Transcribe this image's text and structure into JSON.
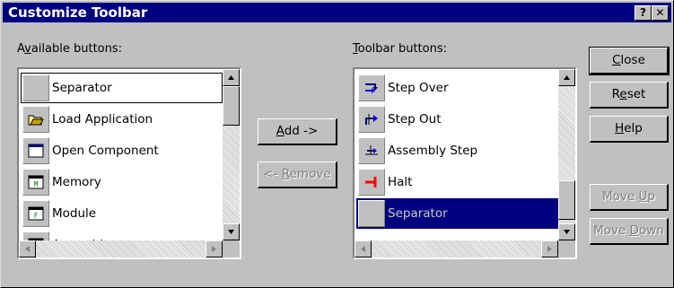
{
  "window": {
    "title": "Customize Toolbar",
    "help_glyph": "?",
    "close_glyph": "✕"
  },
  "available": {
    "label_pre": "A",
    "label_mn": "v",
    "label_post": "ailable buttons:",
    "items": [
      {
        "label": "Separator",
        "icon": "blank-icon"
      },
      {
        "label": "Load Application",
        "icon": "folder-open-icon"
      },
      {
        "label": "Open Component",
        "icon": "window-icon"
      },
      {
        "label": "Memory",
        "icon": "memory-icon",
        "glyph": "M"
      },
      {
        "label": "Module",
        "icon": "module-icon",
        "glyph": "F"
      },
      {
        "label": "Assembly",
        "icon": "assembly-icon",
        "glyph": "A"
      }
    ]
  },
  "toolbar": {
    "label_mn": "T",
    "label_post": "oolbar buttons:",
    "items": [
      {
        "label": "Step Over",
        "icon": "step-over-icon"
      },
      {
        "label": "Step Out",
        "icon": "step-out-icon"
      },
      {
        "label": "Assembly Step",
        "icon": "assembly-step-icon"
      },
      {
        "label": "Halt",
        "icon": "halt-icon"
      },
      {
        "label": "Separator",
        "icon": "blank-icon",
        "selected": true
      }
    ]
  },
  "buttons": {
    "add_mn": "A",
    "add_post": "dd ->",
    "remove_pre": "<- ",
    "remove_mn": "R",
    "remove_post": "emove",
    "close_mn": "C",
    "close_post": "lose",
    "reset_pre": "R",
    "reset_mn": "e",
    "reset_post": "set",
    "help_mn": "H",
    "help_post": "elp",
    "moveup_pre": "Move ",
    "moveup_mn": "U",
    "moveup_post": "p",
    "movedown_pre": "Move ",
    "movedown_mn": "D",
    "movedown_post": "own"
  },
  "colors": {
    "titlebar": "#000080",
    "selection": "#000080",
    "face": "#c0c0c0"
  }
}
